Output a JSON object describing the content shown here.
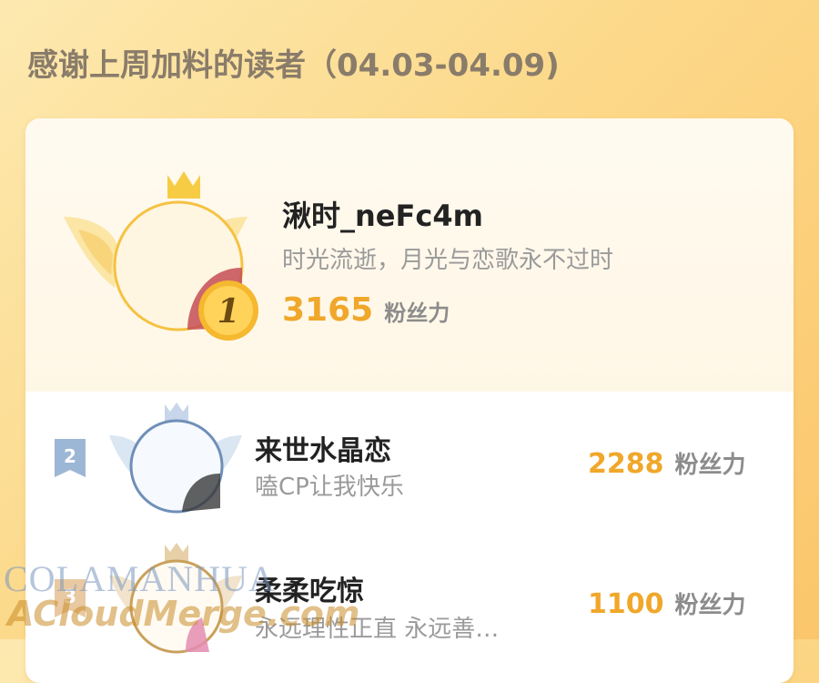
{
  "header": {
    "title": "感谢上周加料的读者（04.03-04.09)"
  },
  "ranking": [
    {
      "rank": "1",
      "name": "湫时_neFc4m",
      "bio": "时光流逝，月光与恋歌永不过时",
      "score": "3165",
      "unit": "粉丝力"
    },
    {
      "rank": "2",
      "name": "来世水晶恋",
      "bio": "嗑CP让我快乐",
      "score": "2288",
      "unit": "粉丝力"
    },
    {
      "rank": "3",
      "name": "柔柔吃惊",
      "bio": "永远理性正直 永远善…",
      "score": "1100",
      "unit": "粉丝力"
    }
  ],
  "watermark": {
    "line1": "COLAMANHUA",
    "line2": "ACloudMerge.com"
  },
  "colors": {
    "accent": "#f0a72a",
    "gold": "#f5c242",
    "silver": "#8aa6c9"
  }
}
